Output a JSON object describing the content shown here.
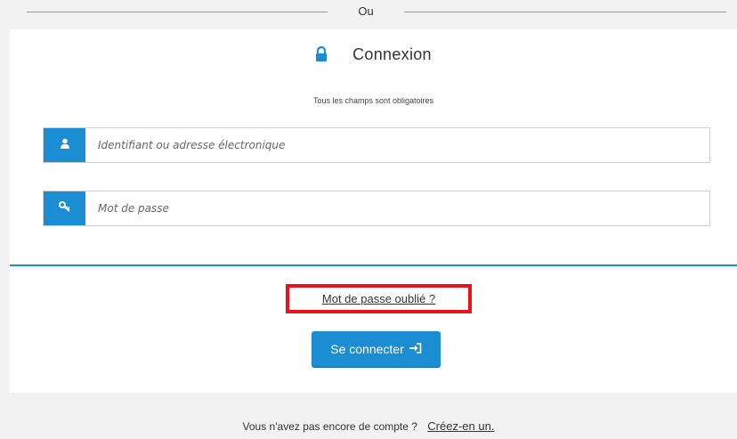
{
  "divider": {
    "text": "Ou"
  },
  "login": {
    "title": "Connexion",
    "required_note": "Tous les champs sont obligatoires",
    "username": {
      "placeholder": "Identifiant ou adresse électronique",
      "value": "",
      "icon": "user-icon"
    },
    "password": {
      "placeholder": "Mot de passe",
      "value": "",
      "icon": "key-icon"
    },
    "forgot_link": "Mot de passe oublié ?",
    "submit_label": "Se connecter",
    "submit_icon": "sign-in-icon",
    "lock_icon": "lock-icon"
  },
  "footer": {
    "question": "Vous n'avez pas encore de compte ?",
    "create_link": "Créez-en un."
  },
  "colors": {
    "accent": "#1a8dd3",
    "highlight": "#e8131b"
  }
}
